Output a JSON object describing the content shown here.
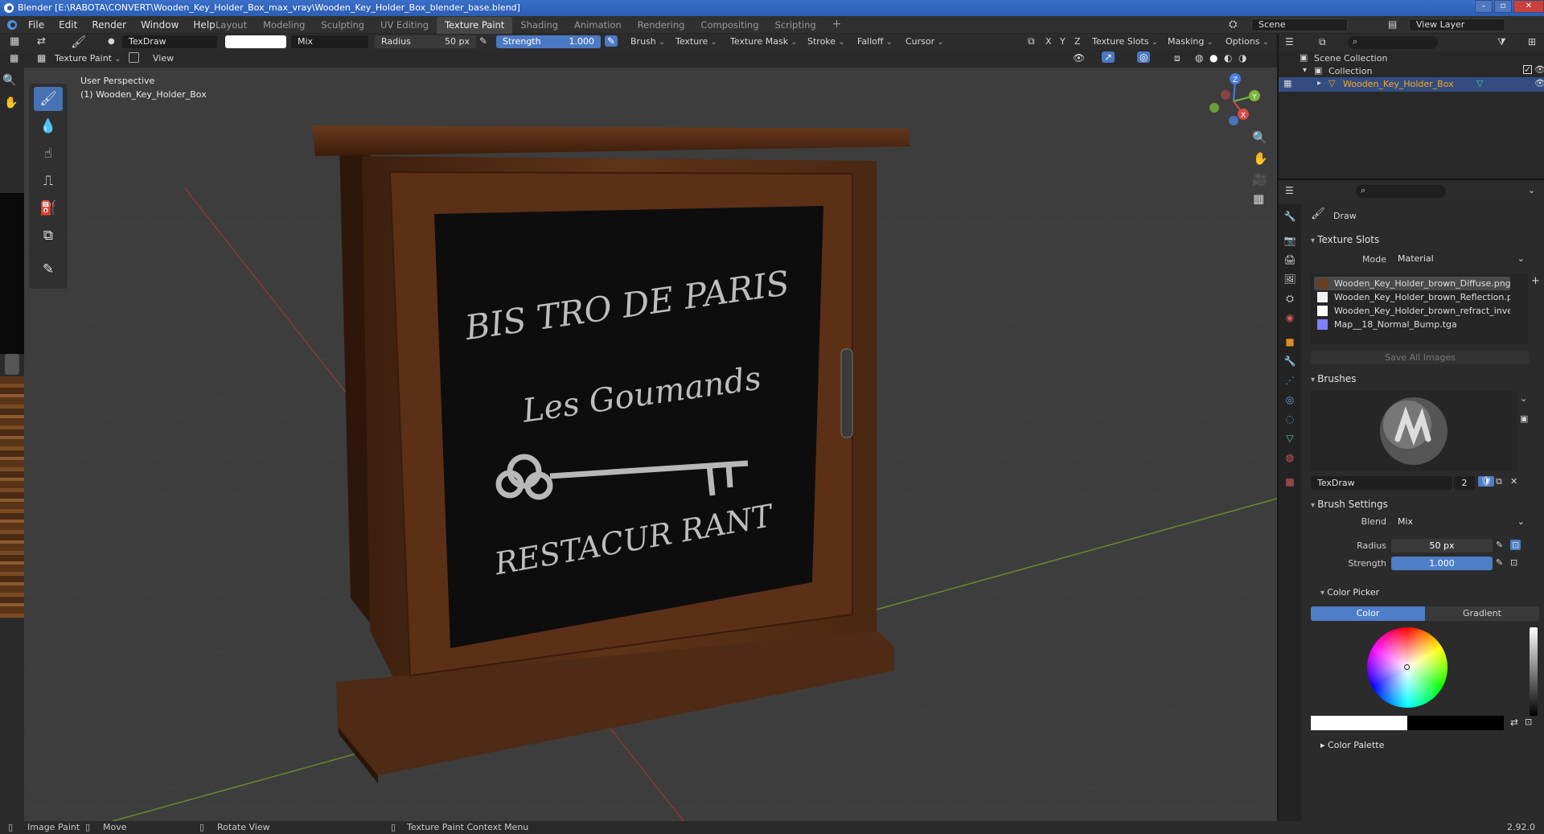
{
  "window": {
    "title": "Blender [E:\\RABOTA\\CONVERT\\Wooden_Key_Holder_Box_max_vray\\Wooden_Key_Holder_Box_blender_base.blend]"
  },
  "menu": [
    "File",
    "Edit",
    "Render",
    "Window",
    "Help"
  ],
  "workspaces": [
    "Layout",
    "Modeling",
    "Sculpting",
    "UV Editing",
    "Texture Paint",
    "Shading",
    "Animation",
    "Rendering",
    "Compositing",
    "Scripting"
  ],
  "active_workspace": "Texture Paint",
  "scene": "Scene",
  "view_layer": "View Layer",
  "tool_header": {
    "brush_name": "TexDraw",
    "blend": "Mix",
    "radius_label": "Radius",
    "radius_value": "50 px",
    "strength_label": "Strength",
    "strength_value": "1.000",
    "menus": [
      "Brush",
      "Texture",
      "Texture Mask",
      "Stroke",
      "Falloff",
      "Cursor"
    ],
    "axes": [
      "X",
      "Y",
      "Z"
    ],
    "right_menus": [
      "Texture Slots",
      "Masking",
      "Options"
    ]
  },
  "view_header": {
    "mode": "Texture Paint",
    "view": "View"
  },
  "viewport": {
    "perspective": "User Perspective",
    "object_info": "(1) Wooden_Key_Holder_Box",
    "sign_line1": "BIS TRO DE PARIS",
    "sign_line2": "Les Goumands",
    "sign_line3": "RESTACUR RANT",
    "gizmo": {
      "x": "X",
      "y": "Y",
      "z": "Z"
    }
  },
  "outliner": {
    "scene_collection": "Scene Collection",
    "collection": "Collection",
    "object": "Wooden_Key_Holder_Box"
  },
  "properties": {
    "tool_name": "Draw",
    "texture_slots_title": "Texture Slots",
    "mode_label": "Mode",
    "mode_value": "Material",
    "texture_slots": [
      {
        "name": "Wooden_Key_Holder_brown_Diffuse.png",
        "color": "#6b3e1f"
      },
      {
        "name": "Wooden_Key_Holder_brown_Reflection.png",
        "color": "#f2f2f2"
      },
      {
        "name": "Wooden_Key_Holder_brown_refract_invert...",
        "color": "#ffffff"
      },
      {
        "name": "Map__18_Normal_Bump.tga",
        "color": "#8080ff"
      }
    ],
    "save_all": "Save All Images",
    "brushes_title": "Brushes",
    "brush_name": "TexDraw",
    "brush_users": "2",
    "brush_settings_title": "Brush Settings",
    "blend_label": "Blend",
    "blend_value": "Mix",
    "radius_label": "Radius",
    "radius_value": "50 px",
    "strength_label": "Strength",
    "strength_value": "1.000",
    "color_picker_title": "Color Picker",
    "color_tab": "Color",
    "gradient_tab": "Gradient",
    "color_palette_title": "Color Palette"
  },
  "status": {
    "item1": "Image Paint",
    "item2": "Move",
    "item3": "Rotate View",
    "item4": "Texture Paint Context Menu",
    "version": "2.92.0"
  },
  "colors": {
    "accent": "#4772b3",
    "viewport_bg": "#3d3d3d",
    "selected_object": "#f5a623"
  }
}
